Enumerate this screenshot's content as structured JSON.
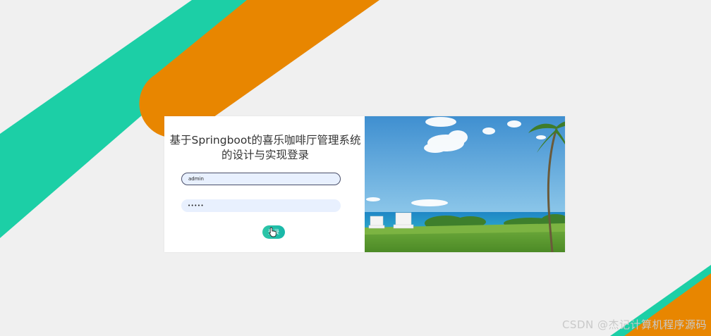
{
  "login": {
    "title": "基于Springboot的喜乐咖啡厅管理系统的设计与实现登录",
    "username_value": "admin",
    "password_mask": "•••••",
    "button_label": "登录"
  },
  "watermark": {
    "text": "CSDN @杰记计算机程序源码"
  },
  "colors": {
    "page_background": "#f0f0f0",
    "teal_band": "#1ccfa6",
    "orange_band": "#e88600",
    "button": "#2ec6a7",
    "input_background": "#e8f0fe"
  },
  "icons": {
    "cursor": "hand-pointer-icon"
  }
}
